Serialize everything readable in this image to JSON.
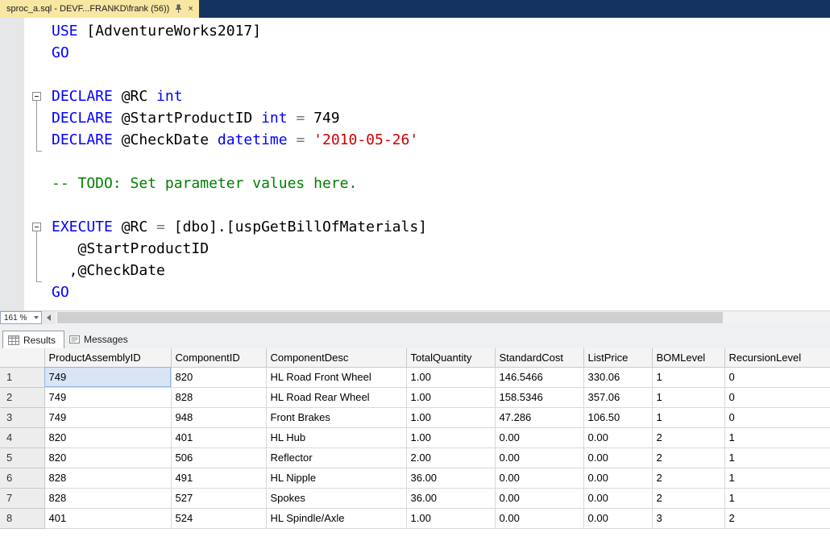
{
  "window": {
    "tab_title": "sproc_a.sql - DEVF...FRANKD\\frank (56))"
  },
  "icons": {
    "pin": "pushpin",
    "close": "×",
    "results_tab": "grid",
    "messages_tab": "note",
    "zoom_dropdown": "chevron-down",
    "scroll_left": "triangle-left"
  },
  "editor": {
    "zoom": "161 %",
    "lines": [
      {
        "segments": [
          {
            "text": "USE",
            "type": "kw"
          },
          {
            "text": " [AdventureWorks2017]",
            "type": "id"
          }
        ]
      },
      {
        "segments": [
          {
            "text": "GO",
            "type": "kw"
          }
        ]
      },
      {
        "segments": []
      },
      {
        "collapse": true,
        "region_end": 5,
        "segments": [
          {
            "text": "DECLARE",
            "type": "kw"
          },
          {
            "text": " @RC ",
            "type": "id"
          },
          {
            "text": "int",
            "type": "kw"
          }
        ]
      },
      {
        "segments": [
          {
            "text": "DECLARE",
            "type": "kw"
          },
          {
            "text": " @StartProductID ",
            "type": "id"
          },
          {
            "text": "int",
            "type": "kw"
          },
          {
            "text": " ",
            "type": "id"
          },
          {
            "text": "=",
            "type": "op"
          },
          {
            "text": " 749",
            "type": "id"
          }
        ]
      },
      {
        "segments": [
          {
            "text": "DECLARE",
            "type": "kw"
          },
          {
            "text": " @CheckDate ",
            "type": "id"
          },
          {
            "text": "datetime",
            "type": "kw"
          },
          {
            "text": " ",
            "type": "id"
          },
          {
            "text": "=",
            "type": "op"
          },
          {
            "text": " ",
            "type": "id"
          },
          {
            "text": "'2010-05-26'",
            "type": "str"
          }
        ]
      },
      {
        "segments": []
      },
      {
        "segments": [
          {
            "text": "-- TODO: Set parameter values here.",
            "type": "cmt"
          }
        ]
      },
      {
        "segments": []
      },
      {
        "collapse": true,
        "region_end": 11,
        "segments": [
          {
            "text": "EXECUTE",
            "type": "kw"
          },
          {
            "text": " @RC ",
            "type": "id"
          },
          {
            "text": "=",
            "type": "op"
          },
          {
            "text": " [dbo].[uspGetBillOfMaterials]",
            "type": "id"
          }
        ]
      },
      {
        "segments": [
          {
            "text": "   @StartProductID",
            "type": "id"
          }
        ]
      },
      {
        "segments": [
          {
            "text": "  ,@CheckDate",
            "type": "id"
          }
        ]
      },
      {
        "segments": [
          {
            "text": "GO",
            "type": "kw"
          }
        ]
      }
    ]
  },
  "results": {
    "tabs": [
      {
        "label": "Results",
        "active": true
      },
      {
        "label": "Messages",
        "active": false
      }
    ],
    "grid": {
      "columns": [
        "ProductAssemblyID",
        "ComponentID",
        "ComponentDesc",
        "TotalQuantity",
        "StandardCost",
        "ListPrice",
        "BOMLevel",
        "RecursionLevel"
      ],
      "rows": [
        [
          "749",
          "820",
          "HL Road Front Wheel",
          "1.00",
          "146.5466",
          "330.06",
          "1",
          "0"
        ],
        [
          "749",
          "828",
          "HL Road Rear Wheel",
          "1.00",
          "158.5346",
          "357.06",
          "1",
          "0"
        ],
        [
          "749",
          "948",
          "Front Brakes",
          "1.00",
          "47.286",
          "106.50",
          "1",
          "0"
        ],
        [
          "820",
          "401",
          "HL Hub",
          "1.00",
          "0.00",
          "0.00",
          "2",
          "1"
        ],
        [
          "820",
          "506",
          "Reflector",
          "2.00",
          "0.00",
          "0.00",
          "2",
          "1"
        ],
        [
          "828",
          "491",
          "HL Nipple",
          "36.00",
          "0.00",
          "0.00",
          "2",
          "1"
        ],
        [
          "828",
          "527",
          "Spokes",
          "36.00",
          "0.00",
          "0.00",
          "2",
          "1"
        ],
        [
          "401",
          "524",
          "HL Spindle/Axle",
          "1.00",
          "0.00",
          "0.00",
          "3",
          "2"
        ]
      ],
      "selection": {
        "row_index": 0,
        "col_index": 0
      }
    }
  },
  "colors": {
    "keyword": "#0000ff",
    "string": "#cc0000",
    "comment": "#008000",
    "titlebar_bg": "#15335f",
    "tab_active_bg": "#f8e7a2",
    "selected_cell_bg": "#d7e5f4"
  }
}
